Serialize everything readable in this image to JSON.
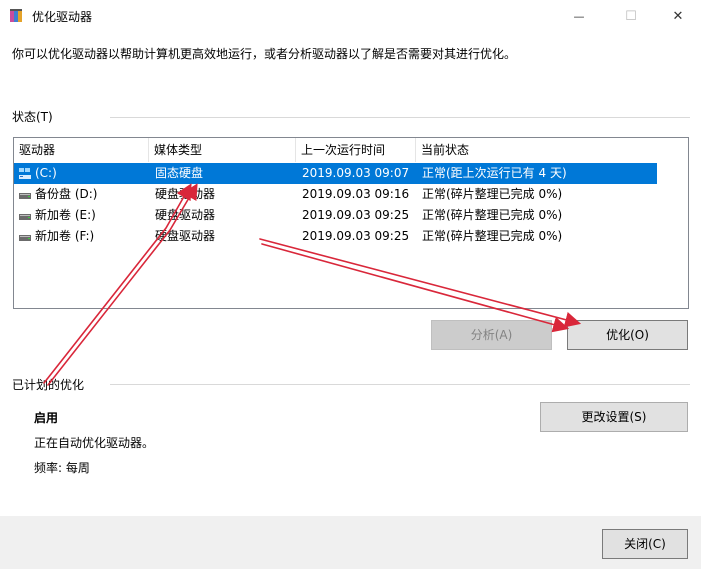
{
  "window": {
    "title": "优化驱动器",
    "controls": {
      "minimize": "—",
      "maximize": "☐",
      "close": "✕"
    }
  },
  "intro_text": "你可以优化驱动器以帮助计算机更高效地运行，或者分析驱动器以了解是否需要对其进行优化。",
  "status_section": {
    "label": "状态(T)",
    "columns": [
      "驱动器",
      "媒体类型",
      "上一次运行时间",
      "当前状态"
    ],
    "rows": [
      {
        "drive": "(C:)",
        "media": "固态硬盘",
        "last_run": "2019.09.03 09:07",
        "status": "正常(距上次运行已有 4 天)",
        "icon": "windows-drive-icon",
        "selected": true
      },
      {
        "drive": "备份盘 (D:)",
        "media": "硬盘驱动器",
        "last_run": "2019.09.03 09:16",
        "status": "正常(碎片整理已完成 0%)",
        "icon": "hard-drive-icon",
        "selected": false
      },
      {
        "drive": "新加卷 (E:)",
        "media": "硬盘驱动器",
        "last_run": "2019.09.03 09:25",
        "status": "正常(碎片整理已完成 0%)",
        "icon": "hard-drive-icon",
        "selected": false
      },
      {
        "drive": "新加卷 (F:)",
        "media": "硬盘驱动器",
        "last_run": "2019.09.03 09:25",
        "status": "正常(碎片整理已完成 0%)",
        "icon": "hard-drive-icon",
        "selected": false
      }
    ],
    "analyze_button": "分析(A)",
    "optimize_button": "优化(O)"
  },
  "schedule_section": {
    "label": "已计划的优化",
    "status": "启用",
    "description": "正在自动优化驱动器。",
    "frequency": "频率: 每周",
    "change_settings_button": "更改设置(S)"
  },
  "footer": {
    "close_button": "关闭(C)"
  },
  "colors": {
    "selection": "#0078d7",
    "annotation_arrow": "#d9273a",
    "footer_bg": "#f0f0f0"
  }
}
